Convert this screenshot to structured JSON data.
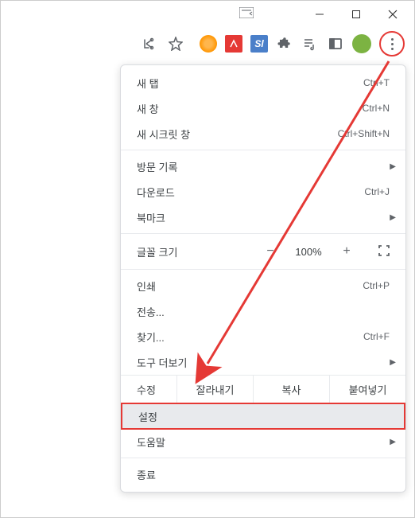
{
  "window": {
    "minimize": "—",
    "maximize": "▢",
    "close": "✕"
  },
  "menu": {
    "new_tab": {
      "label": "새 탭",
      "shortcut": "Ctrl+T"
    },
    "new_window": {
      "label": "새 창",
      "shortcut": "Ctrl+N"
    },
    "incognito": {
      "label": "새 시크릿 창",
      "shortcut": "Ctrl+Shift+N"
    },
    "history": {
      "label": "방문 기록"
    },
    "downloads": {
      "label": "다운로드",
      "shortcut": "Ctrl+J"
    },
    "bookmarks": {
      "label": "북마크"
    },
    "zoom": {
      "label": "글꼴 크기",
      "minus": "−",
      "value": "100%",
      "plus": "+"
    },
    "print": {
      "label": "인쇄",
      "shortcut": "Ctrl+P"
    },
    "cast": {
      "label": "전송..."
    },
    "find": {
      "label": "찾기...",
      "shortcut": "Ctrl+F"
    },
    "more_tools": {
      "label": "도구 더보기"
    },
    "edit": {
      "label": "수정",
      "cut": "잘라내기",
      "copy": "복사",
      "paste": "붙여넣기"
    },
    "settings": {
      "label": "설정"
    },
    "help": {
      "label": "도움말"
    },
    "exit": {
      "label": "종료"
    }
  },
  "ext": {
    "sl": "Sl"
  }
}
